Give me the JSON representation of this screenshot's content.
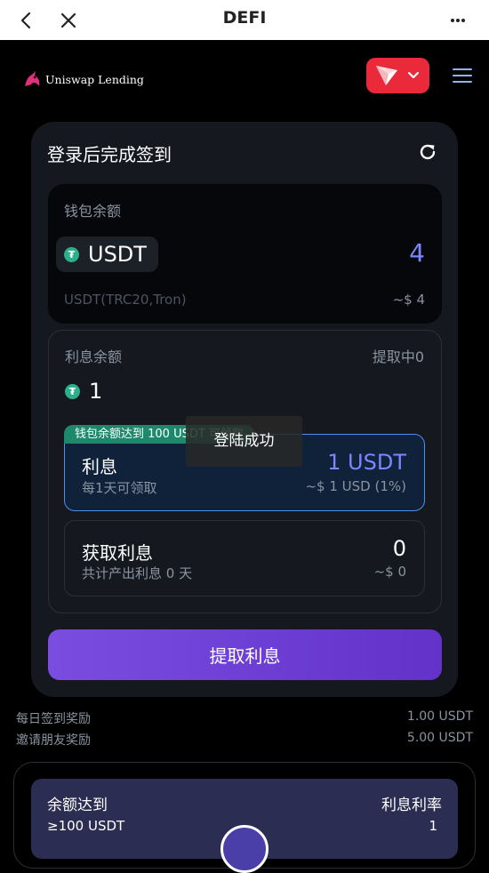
{
  "topbar": {
    "title": "DEFI"
  },
  "brand": {
    "name": "Uniswap Lending"
  },
  "card": {
    "title": "登录后完成签到"
  },
  "wallet": {
    "label": "钱包余额",
    "token": "USDT",
    "amount": "4",
    "network": "USDT(TRC20,Tron)",
    "usd": "~$ 4"
  },
  "interest": {
    "label": "利息余额",
    "status": "提取中0",
    "amount": "1",
    "tag": "钱包余额达到 100 USDT 可领取",
    "row1": {
      "title": "利息",
      "sub": "每1天可领取",
      "value": "1 USDT",
      "usd": "~$ 1 USD (1%)"
    },
    "row2": {
      "title": "获取利息",
      "sub": "共计产出利息 0 天",
      "value": "0",
      "usd": "~$ 0"
    }
  },
  "withdraw_button": "提取利息",
  "toast": "登陆成功",
  "rewards": [
    {
      "label": "每日签到奖励",
      "value": "1.00 USDT"
    },
    {
      "label": "邀请朋友奖励",
      "value": "5.00 USDT"
    }
  ],
  "tier": {
    "left_title": "余额达到",
    "left_value": "≥100 USDT",
    "right_title": "利息利率",
    "right_value": "1"
  },
  "colors": {
    "accent": "#7b86ff",
    "button": "#6f3fd6",
    "tron_red": "#ea2a3b",
    "tether_green": "#2bb08a"
  }
}
